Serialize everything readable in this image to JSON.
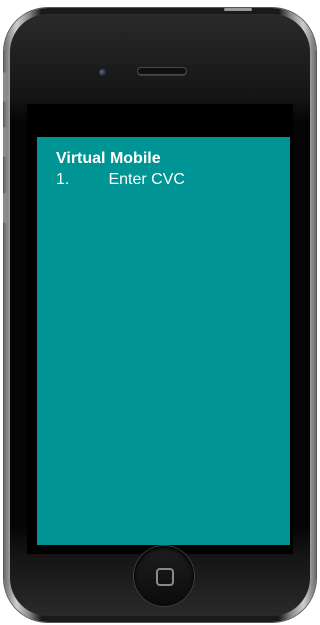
{
  "screen": {
    "title": "Virtual Mobile",
    "steps": [
      {
        "number": "1.",
        "label": "Enter CVC"
      }
    ],
    "background_color": "#009494"
  },
  "device": {
    "type": "phone",
    "home_button_icon": "home-square-icon",
    "camera_icon": "front-camera-icon",
    "speaker_icon": "earpiece-speaker-icon"
  }
}
